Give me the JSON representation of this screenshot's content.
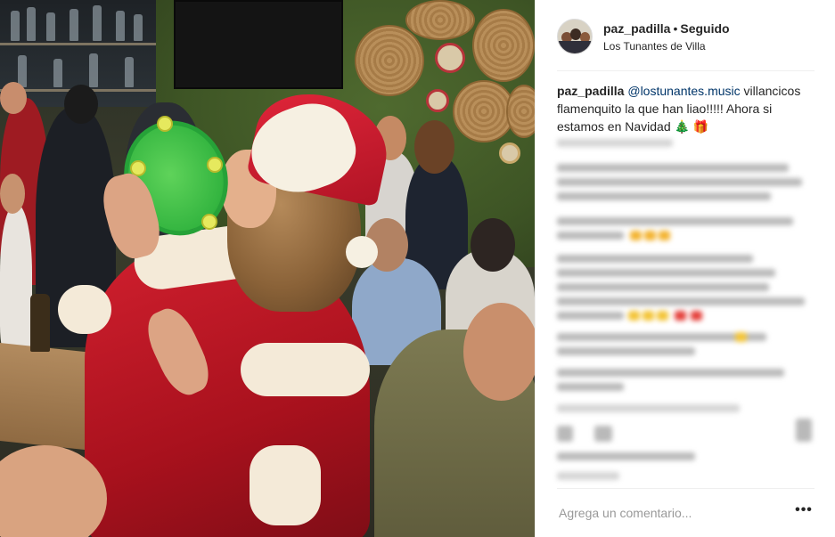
{
  "post": {
    "image_alt": "Video de mujer vestida de Papá Noel tocando una pandereta en un bar"
  },
  "header": {
    "username": "paz_padilla",
    "separator": "•",
    "follow_status": "Seguido",
    "location": "Los Tunantes de Villa"
  },
  "caption": {
    "username": "paz_padilla",
    "mention": "@lostunantes.music",
    "text": " villancicos flamenquito la que han liao!!!!! Ahora si estamos en Navidad ",
    "emoji_tree": "🎄",
    "emoji_gift": "🎁"
  },
  "comment_box": {
    "placeholder": "Agrega un comentario...",
    "more_options": "•••"
  },
  "colors": {
    "link": "#003569",
    "text": "#262626",
    "placeholder": "#999999",
    "divider": "#efefef"
  }
}
